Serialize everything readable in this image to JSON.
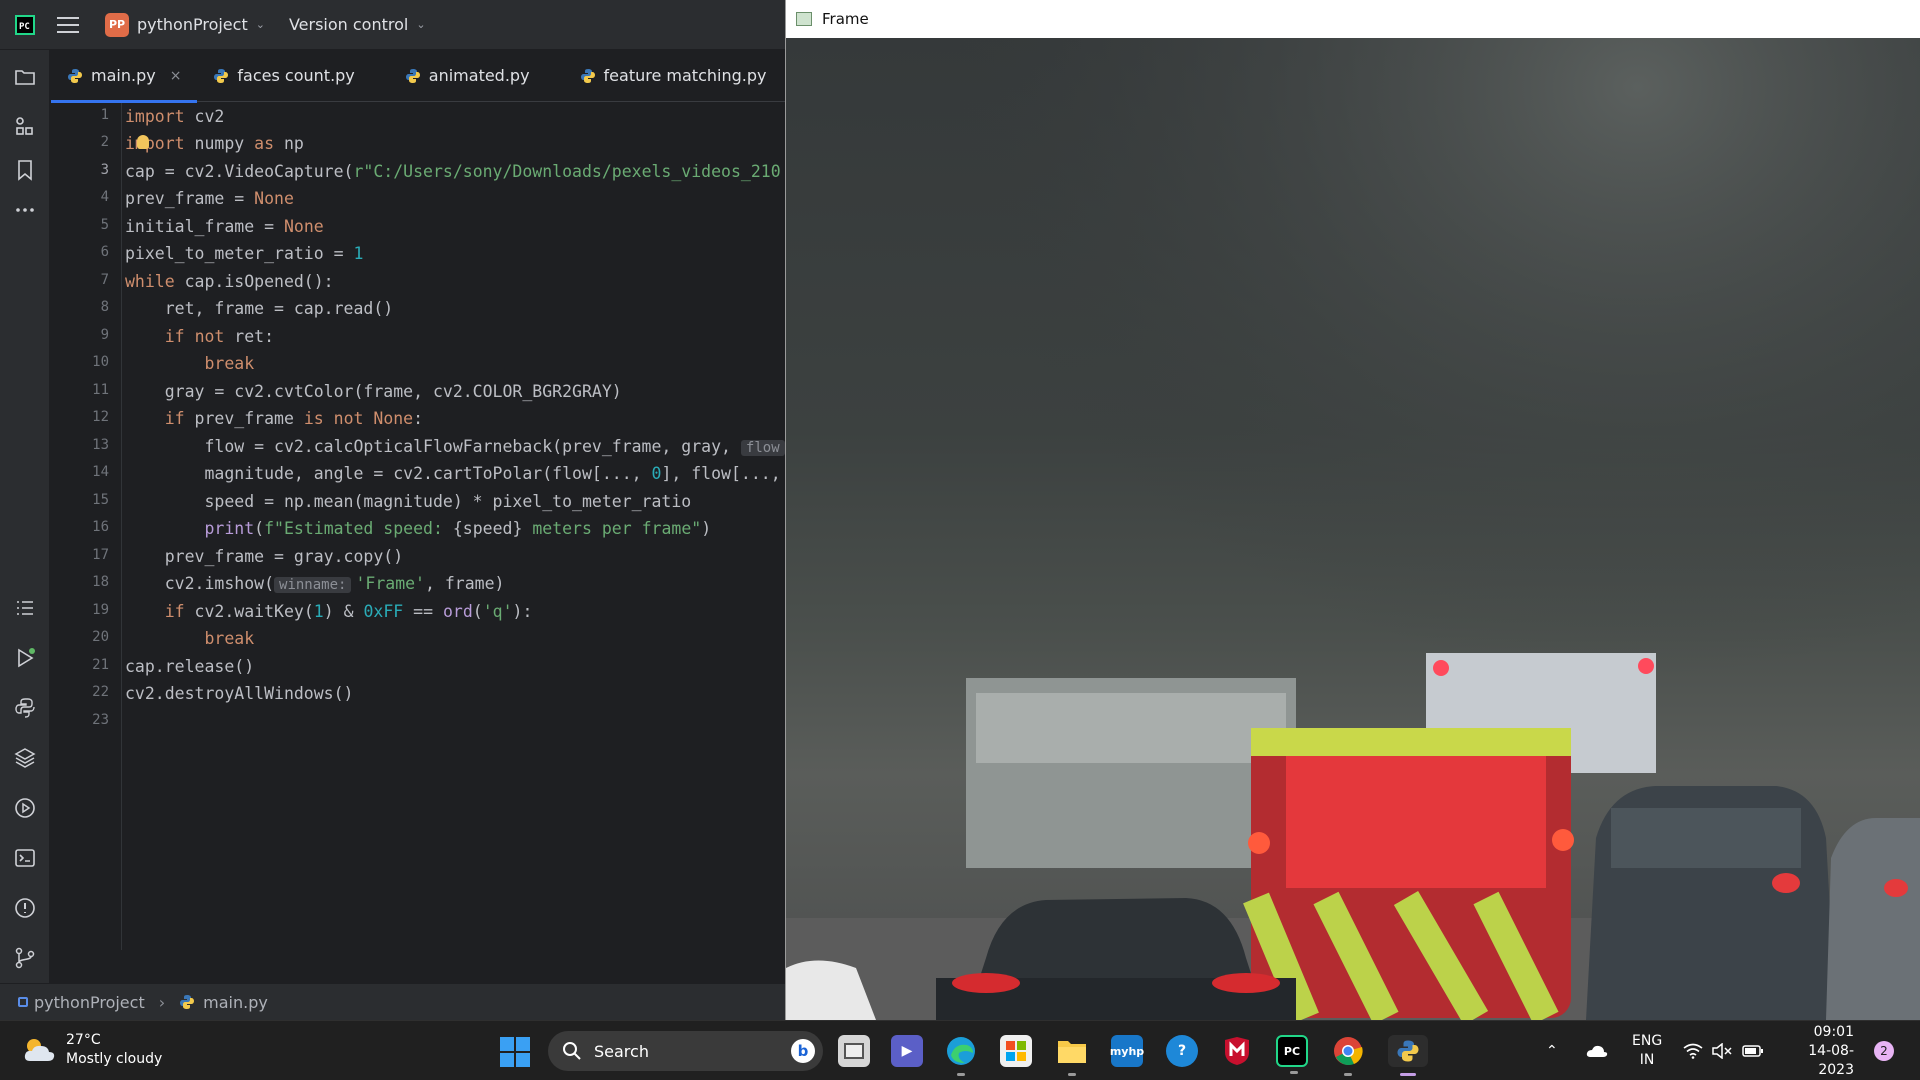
{
  "ide": {
    "project_badge": "PP",
    "project_name": "pythonProject",
    "version_control": "Version control",
    "tabs": [
      {
        "label": "main.py",
        "close": "×"
      },
      {
        "label": "faces count.py"
      },
      {
        "label": "animated.py"
      },
      {
        "label": "feature matching.py"
      }
    ],
    "line_numbers": [
      "1",
      "2",
      "3",
      "4",
      "5",
      "6",
      "7",
      "8",
      "9",
      "10",
      "11",
      "12",
      "13",
      "14",
      "15",
      "16",
      "17",
      "18",
      "19",
      "20",
      "21",
      "22",
      "23"
    ],
    "code": {
      "l1": {
        "kw": "import",
        "rest": " cv2"
      },
      "l2": {
        "kw1": "import",
        "mid": " numpy ",
        "kw2": "as",
        "rest": " np"
      },
      "l3": {
        "pre": "cap = cv2.VideoCapture(",
        "str": "r\"C:/Users/sony/Downloads/pexels_videos_210"
      },
      "l4": {
        "pre": "prev_frame = ",
        "kw": "None"
      },
      "l5": {
        "pre": "initial_frame = ",
        "kw": "None"
      },
      "l6": {
        "pre": "pixel_to_meter_ratio = ",
        "num": "1"
      },
      "l7": {
        "kw": "while",
        "rest": " cap.isOpened():"
      },
      "l8": {
        "rest": "    ret, frame = cap.read()"
      },
      "l9": {
        "indent": "    ",
        "kw1": "if",
        "sp": " ",
        "kw2": "not",
        "rest": " ret:"
      },
      "l10": {
        "indent": "        ",
        "kw": "break"
      },
      "l11": {
        "rest": "    gray = cv2.cvtColor(frame, cv2.COLOR_BGR2GRAY)"
      },
      "l12": {
        "indent": "    ",
        "kw1": "if",
        "mid": " prev_frame ",
        "kw2": "is not None",
        "rest": ":"
      },
      "l13": {
        "rest": "        flow = cv2.calcOpticalFlowFarneback(prev_frame, gray, ",
        "hint": "flow"
      },
      "l14": {
        "pre": "        magnitude, angle = cv2.cartToPolar(flow[..., ",
        "num": "0",
        "rest": "], flow[...,"
      },
      "l15": {
        "rest": "        speed = np.mean(magnitude) * pixel_to_meter_ratio"
      },
      "l16": {
        "indent": "        ",
        "fn": "print",
        "rest": "(",
        "str": "f\"Estimated speed: ",
        "var": "{speed}",
        "str2": " meters per frame\"",
        "end": ")"
      },
      "l17": {
        "rest": "    prev_frame = gray.copy()"
      },
      "l18": {
        "pre": "    cv2.imshow(",
        "hint": "winname:",
        "str": "'Frame'",
        "rest": ", frame)"
      },
      "l19": {
        "indent": "    ",
        "kw": "if",
        "pre": " cv2.waitKey(",
        "num1": "1",
        "mid": ") & ",
        "num2": "0xFF",
        "mid2": " == ",
        "fn": "ord",
        "p": "(",
        "str": "'q'",
        "end": "):"
      },
      "l20": {
        "indent": "        ",
        "kw": "break"
      },
      "l21": {
        "rest": "cap.release()"
      },
      "l22": {
        "rest": "cv2.destroyAllWindows()"
      }
    },
    "breadcrumb": {
      "project": "pythonProject",
      "file": "main.py"
    }
  },
  "frame_window": {
    "title": "Frame"
  },
  "taskbar": {
    "weather_temp": "27°C",
    "weather_desc": "Mostly cloudy",
    "search_placeholder": "Search",
    "lang_top": "ENG",
    "lang_bottom": "IN",
    "time": "09:01",
    "date": "14-08-2023",
    "notifications": "2"
  }
}
